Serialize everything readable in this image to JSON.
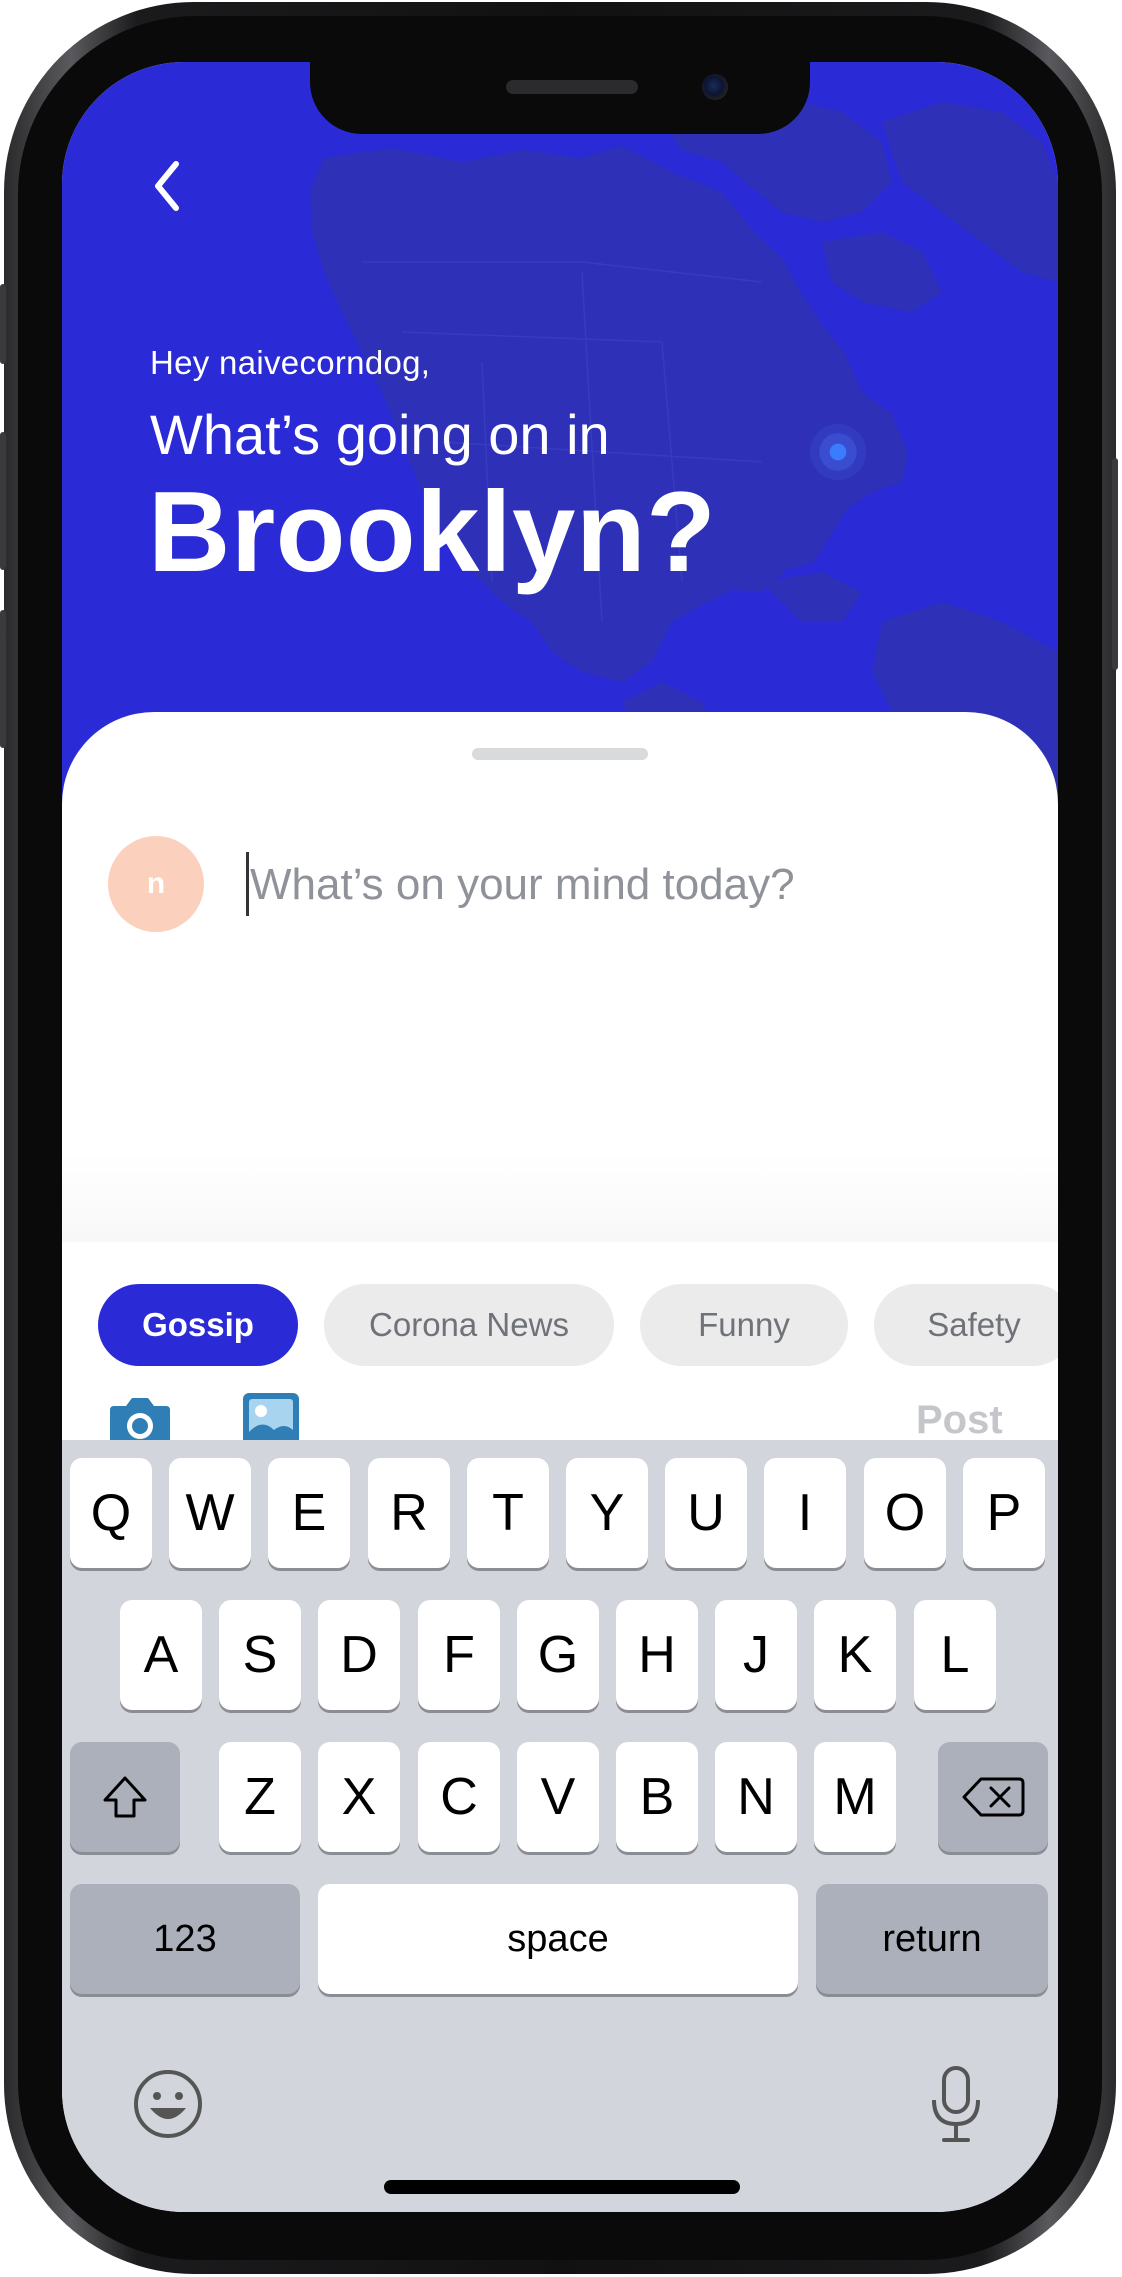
{
  "colors": {
    "brand": "#2a2ad6",
    "avatar_bg": "#fbd1bd",
    "tag_inactive_bg": "#ebebeb",
    "post_disabled": "#c4c6ca",
    "icon_blue": "#2f7fb6"
  },
  "header": {
    "back_icon": "chevron-left-icon",
    "greeting": "Hey naivecorndog,",
    "headline": "What’s going on in",
    "city": "Brooklyn?"
  },
  "composer": {
    "avatar_initial": "n",
    "placeholder": "What’s on your mind today?",
    "value": ""
  },
  "tags": [
    {
      "label": "Gossip",
      "selected": true
    },
    {
      "label": "Corona News",
      "selected": false
    },
    {
      "label": "Funny",
      "selected": false
    },
    {
      "label": "Safety",
      "selected": false
    }
  ],
  "toolbar": {
    "camera_icon": "camera-icon",
    "image_icon": "image-icon",
    "post_label": "Post"
  },
  "keyboard": {
    "row1": [
      "Q",
      "W",
      "E",
      "R",
      "T",
      "Y",
      "U",
      "I",
      "O",
      "P"
    ],
    "row2": [
      "A",
      "S",
      "D",
      "F",
      "G",
      "H",
      "J",
      "K",
      "L"
    ],
    "row3": [
      "Z",
      "X",
      "C",
      "V",
      "B",
      "N",
      "M"
    ],
    "numbers_label": "123",
    "space_label": "space",
    "return_label": "return",
    "shift_icon": "shift-icon",
    "delete_icon": "delete-icon",
    "emoji_icon": "emoji-icon",
    "mic_icon": "microphone-icon"
  }
}
